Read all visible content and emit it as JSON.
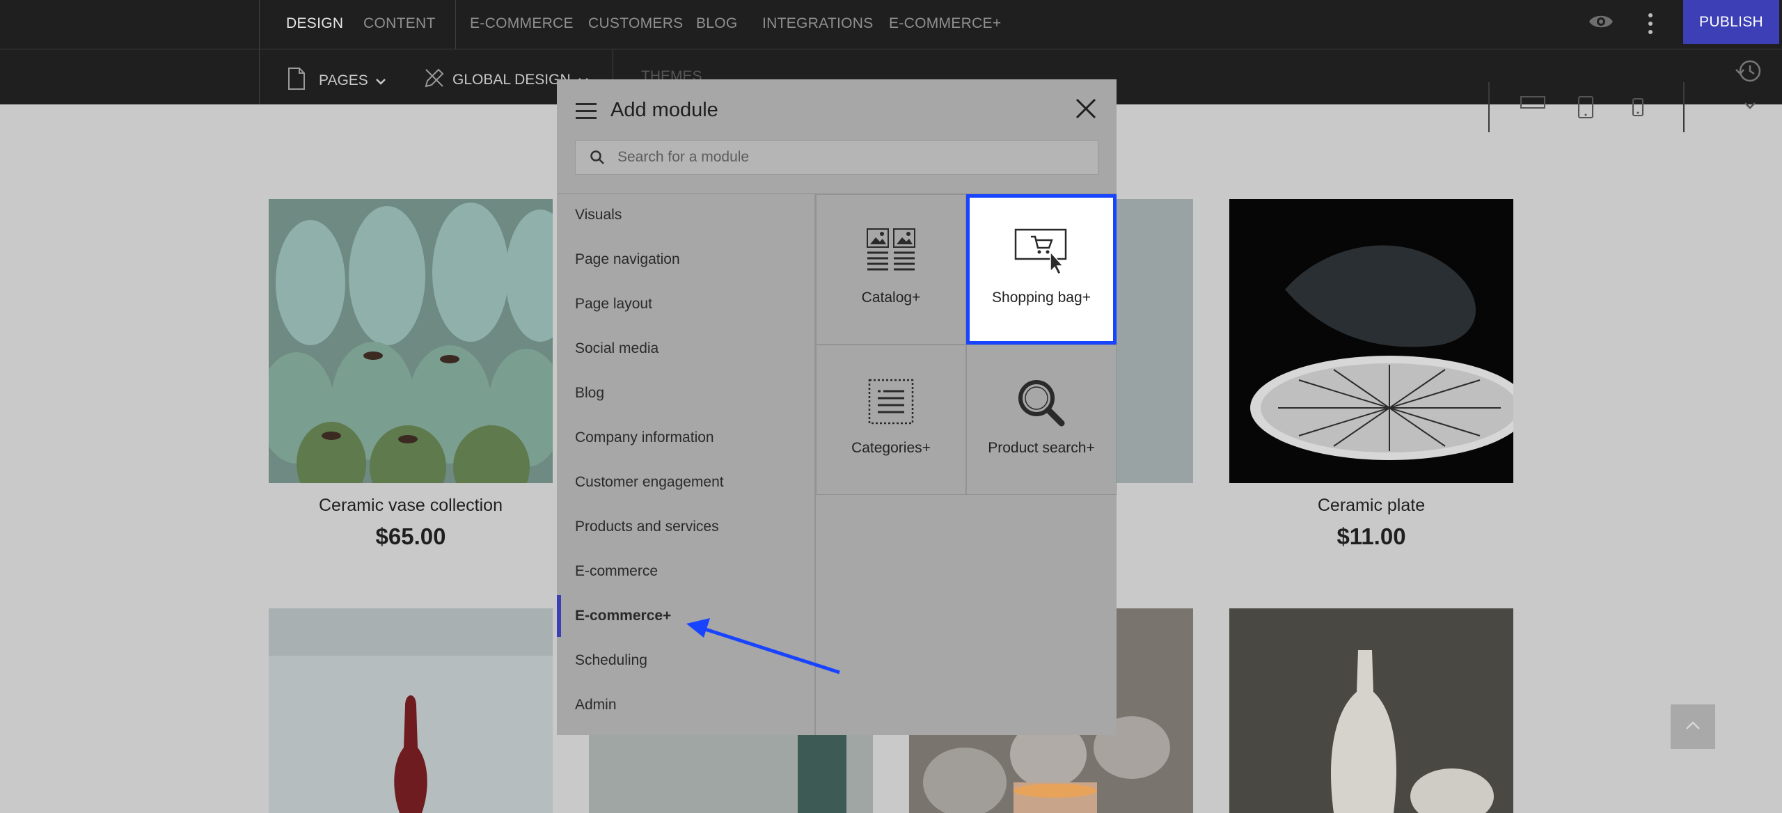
{
  "topbar": {
    "tabs": [
      {
        "label": "DESIGN",
        "active": true
      },
      {
        "label": "CONTENT",
        "active": false
      }
    ],
    "menu": [
      "E-COMMERCE",
      "CUSTOMERS",
      "BLOG",
      "INTEGRATIONS",
      "E-COMMERCE+"
    ],
    "publish_label": "PUBLISH",
    "pages_label": "PAGES",
    "global_design_label": "GLOBAL DESIGN",
    "themes_label": "THEMES"
  },
  "products": [
    {
      "title": "Ceramic vase collection",
      "price": "$65.00"
    },
    {
      "title": "Ceramic plate",
      "price": "$11.00"
    }
  ],
  "modal": {
    "title": "Add module",
    "search_placeholder": "Search for a module",
    "categories": [
      "Visuals",
      "Page navigation",
      "Page layout",
      "Social media",
      "Blog",
      "Company information",
      "Customer engagement",
      "Products and services",
      "E-commerce",
      "E-commerce+",
      "Scheduling",
      "Admin"
    ],
    "active_category": "E-commerce+",
    "modules": [
      {
        "label": "Catalog+",
        "icon": "catalog-icon",
        "selected": false
      },
      {
        "label": "Shopping bag+",
        "icon": "shopping-cart-icon",
        "selected": true
      },
      {
        "label": "Categories+",
        "icon": "categories-list-icon",
        "selected": false
      },
      {
        "label": "Product search+",
        "icon": "magnifier-icon",
        "selected": false
      }
    ]
  },
  "colors": {
    "accent": "#3c3fb6",
    "selection": "#1844ff",
    "annotation_arrow": "#1844ff"
  }
}
